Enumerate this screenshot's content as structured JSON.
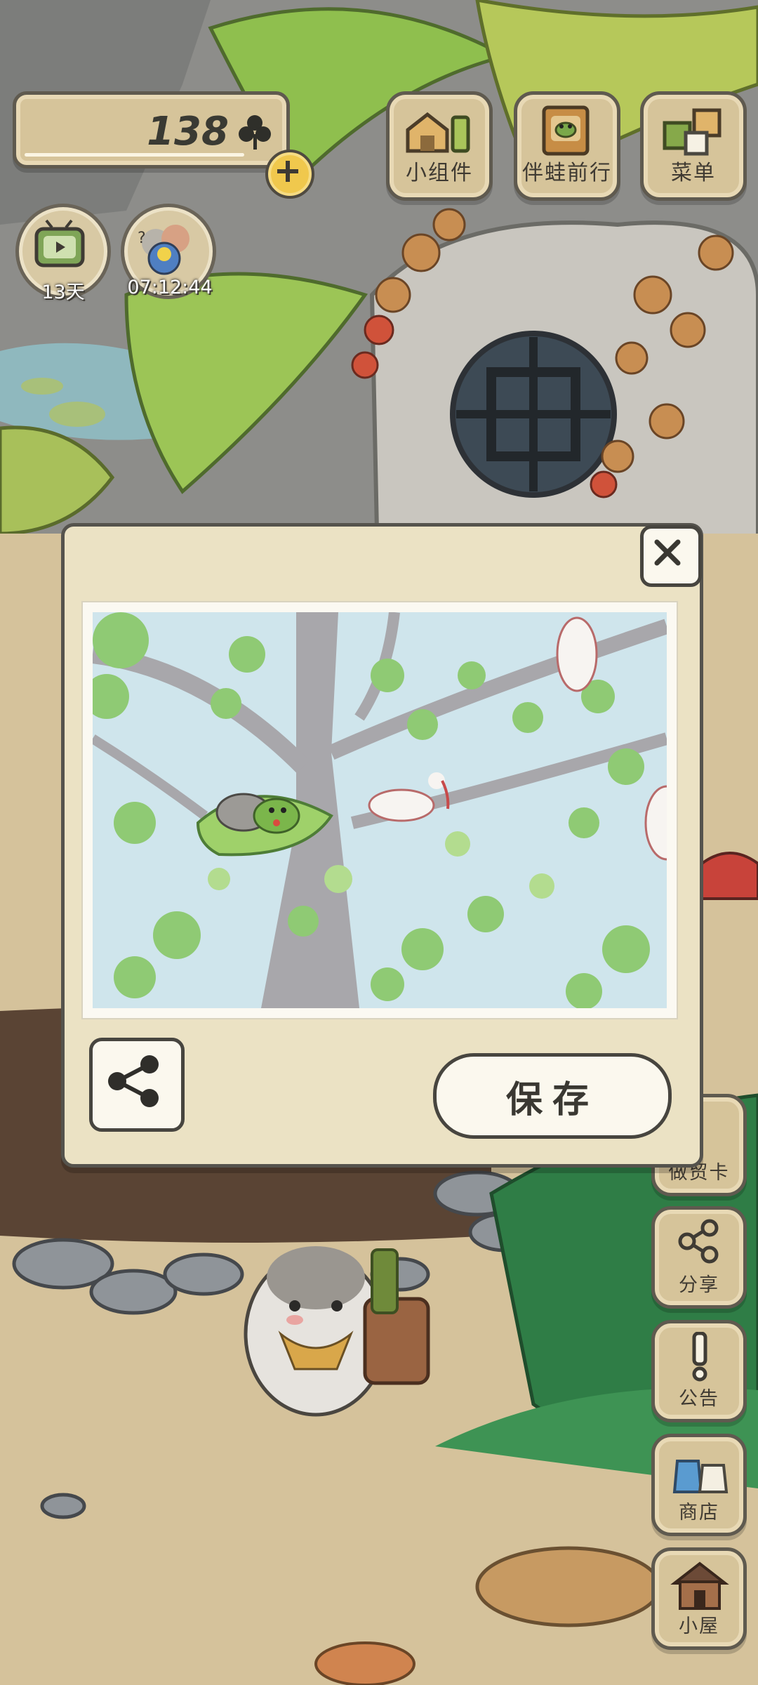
{
  "hud": {
    "clover_count": "138",
    "clover_icon": "clover-icon",
    "tv_timer": "13天",
    "mail_timer": "07:12:44"
  },
  "top_buttons": {
    "widget_label": "小组件",
    "travel_label": "伴蛙前行",
    "menu_label": "菜单"
  },
  "side_buttons": [
    {
      "label": "做贸卡"
    },
    {
      "label": "分享"
    },
    {
      "label": "公告"
    },
    {
      "label": "商店"
    },
    {
      "label": "小屋"
    }
  ],
  "modal": {
    "save_label": "保存",
    "close_icon": "close-icon",
    "share_icon": "share-icon"
  },
  "colors": {
    "wood": "#d6c49a",
    "border": "#5f5a4f",
    "panel": "#ebe2c4",
    "sky": "#cfe5ec"
  }
}
